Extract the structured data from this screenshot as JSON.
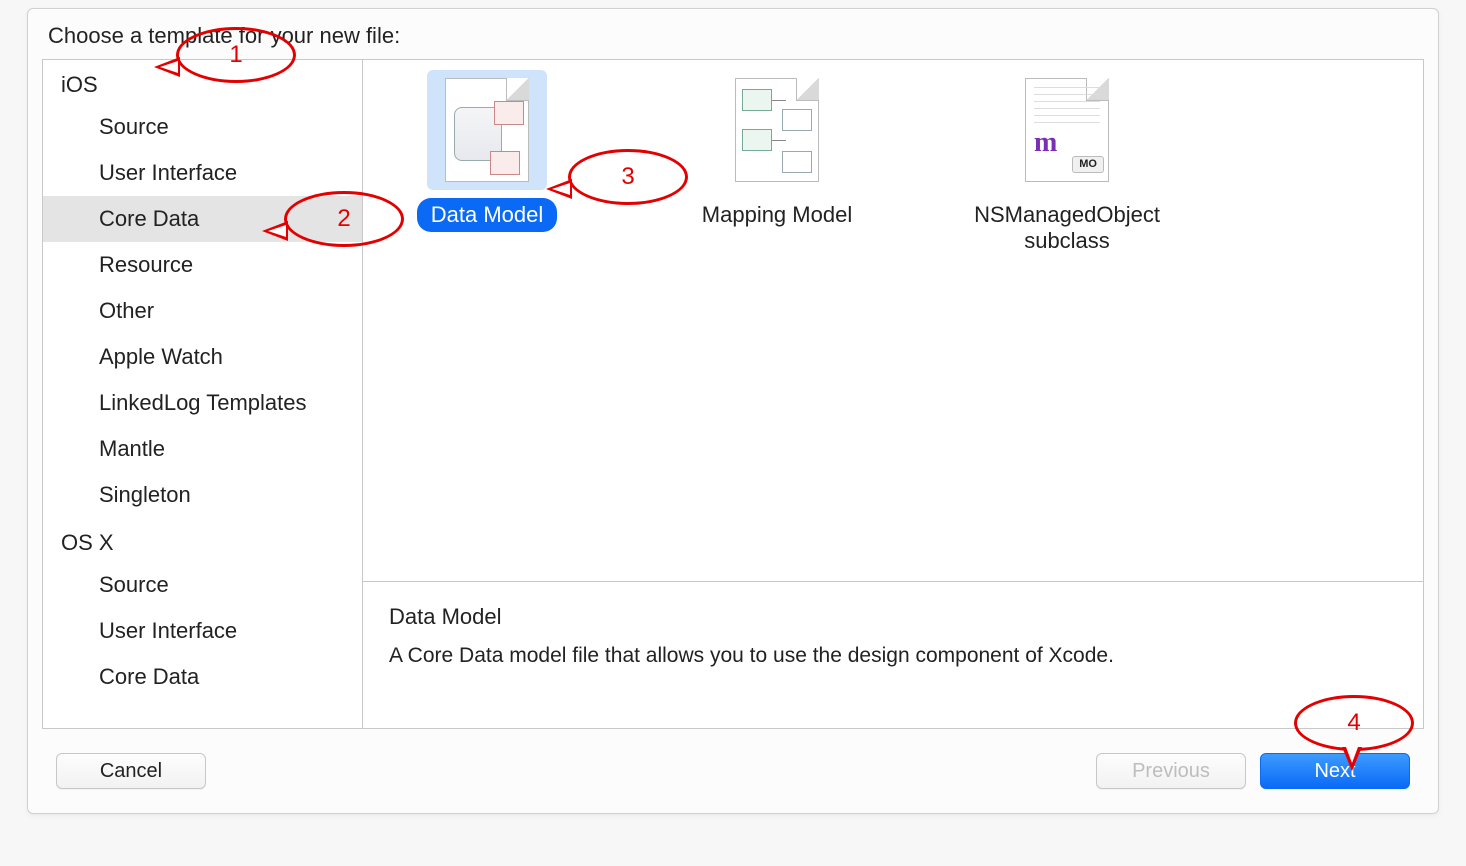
{
  "header": {
    "title": "Choose a template for your new file:"
  },
  "sidebar": {
    "sections": [
      {
        "platform": "iOS",
        "categories": [
          "Source",
          "User Interface",
          "Core Data",
          "Resource",
          "Other",
          "Apple Watch",
          "LinkedLog Templates",
          "Mantle",
          "Singleton"
        ],
        "selected_index": 2
      },
      {
        "platform": "OS X",
        "categories": [
          "Source",
          "User Interface",
          "Core Data"
        ],
        "selected_index": -1
      }
    ]
  },
  "templates": {
    "items": [
      {
        "label": "Data Model",
        "icon": "data-model"
      },
      {
        "label": "Mapping Model",
        "icon": "mapping-model"
      },
      {
        "label": "NSManagedObject subclass",
        "icon": "managed-object"
      }
    ],
    "selected_index": 0
  },
  "description": {
    "title": "Data Model",
    "body": "A Core Data model file that allows you to use the design component of Xcode."
  },
  "buttons": {
    "cancel": "Cancel",
    "previous": "Previous",
    "next": "Next",
    "previous_enabled": false
  },
  "callouts": [
    "1",
    "2",
    "3",
    "4"
  ]
}
